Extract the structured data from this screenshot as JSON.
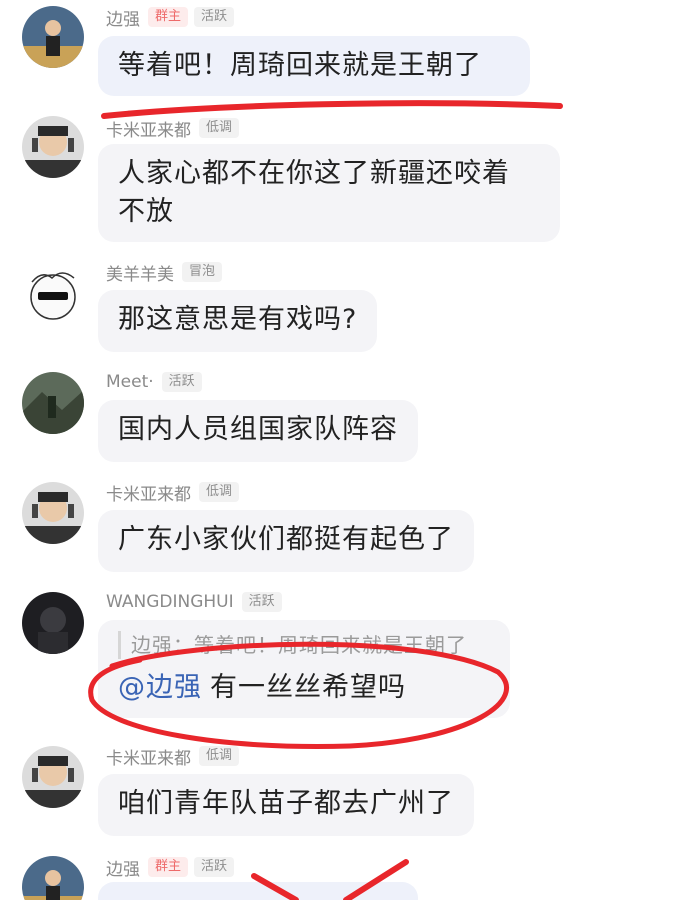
{
  "messages": [
    {
      "name": "边强",
      "badges": [
        "群主",
        "活跃"
      ],
      "text": "等着吧！周琦回来就是王朝了"
    },
    {
      "name": "卡米亚来都",
      "badges": [
        "低调"
      ],
      "text_lines": [
        "人家心都不在你这了新疆还咬着",
        "不放"
      ]
    },
    {
      "name": "美羊羊美",
      "badges": [
        "冒泡"
      ],
      "text": "那这意思是有戏吗?"
    },
    {
      "name": "Meet·",
      "badges": [
        "活跃"
      ],
      "text": "国内人员组国家队阵容"
    },
    {
      "name": "卡米亚来都",
      "badges": [
        "低调"
      ],
      "text": "广东小家伙们都挺有起色了"
    },
    {
      "name": "WANGDINGHUI",
      "badges": [
        "活跃"
      ],
      "quote": "边强：等着吧！周琦回来就是王朝了",
      "mention": "@边强",
      "text": "有一丝丝希望吗"
    },
    {
      "name": "卡米亚来都",
      "badges": [
        "低调"
      ],
      "text": "咱们青年队苗子都去广州了"
    },
    {
      "name": "边强",
      "badges": [
        "群主",
        "活跃"
      ],
      "text": ""
    }
  ],
  "colors": {
    "annotation_red": "#e8262b",
    "mention_blue": "#3a64b5",
    "owner_badge": "#ee6a6a"
  }
}
